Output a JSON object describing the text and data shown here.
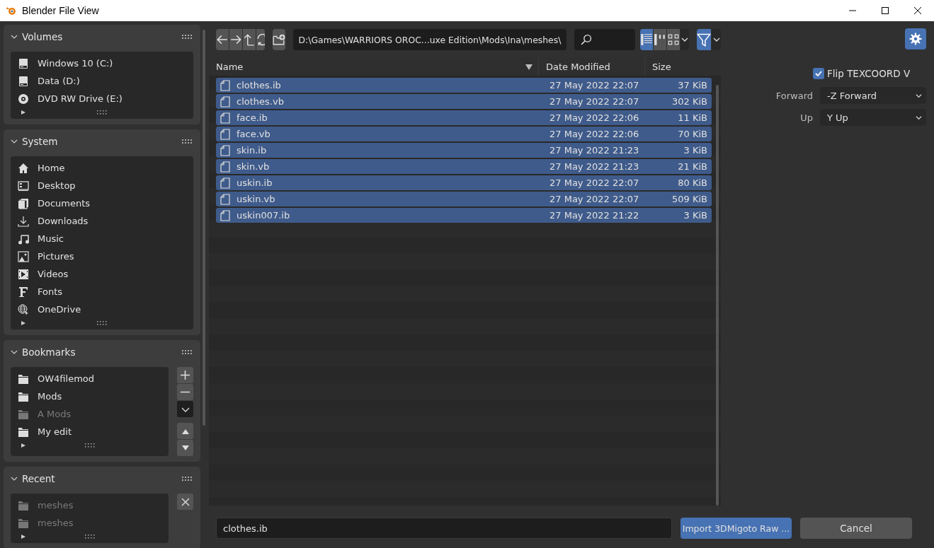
{
  "window": {
    "title": "Blender File View"
  },
  "sidebar": {
    "panels": [
      {
        "title": "Volumes",
        "expanded": true,
        "kind": "volumes",
        "items": [
          {
            "label": "Windows 10 (C:)",
            "kind": "drive",
            "disabled": false
          },
          {
            "label": "Data (D:)",
            "kind": "drive",
            "disabled": false
          },
          {
            "label": "DVD RW Drive (E:)",
            "kind": "disc",
            "disabled": false
          }
        ]
      },
      {
        "title": "System",
        "expanded": true,
        "kind": "system",
        "items": [
          {
            "label": "Home",
            "kind": "home",
            "disabled": false
          },
          {
            "label": "Desktop",
            "kind": "desktop",
            "disabled": false
          },
          {
            "label": "Documents",
            "kind": "documents",
            "disabled": false
          },
          {
            "label": "Downloads",
            "kind": "downloads",
            "disabled": false
          },
          {
            "label": "Music",
            "kind": "music",
            "disabled": false
          },
          {
            "label": "Pictures",
            "kind": "pictures",
            "disabled": false
          },
          {
            "label": "Videos",
            "kind": "videos",
            "disabled": false
          },
          {
            "label": "Fonts",
            "kind": "fonts",
            "disabled": false
          },
          {
            "label": "OneDrive",
            "kind": "network",
            "disabled": false
          }
        ]
      },
      {
        "title": "Bookmarks",
        "expanded": true,
        "kind": "bookmarks",
        "items": [
          {
            "label": "OW4filemod",
            "kind": "folder",
            "disabled": false
          },
          {
            "label": "Mods",
            "kind": "folder",
            "disabled": false
          },
          {
            "label": "A Mods",
            "kind": "folder",
            "disabled": true
          },
          {
            "label": "My edit",
            "kind": "folder",
            "disabled": false
          }
        ]
      },
      {
        "title": "Recent",
        "expanded": true,
        "kind": "recent",
        "items": [
          {
            "label": "meshes",
            "kind": "folder",
            "disabled": true
          },
          {
            "label": "meshes",
            "kind": "folder",
            "disabled": true
          }
        ]
      }
    ]
  },
  "toolbar": {
    "path": "D:\\Games\\WARRIORS OROC...uxe Edition\\Mods\\Ina\\meshes\\",
    "view_modes": [
      {
        "kind": "vertical",
        "selected": true
      },
      {
        "kind": "horizontal",
        "selected": false
      },
      {
        "kind": "thumbnails",
        "selected": false
      }
    ],
    "filter_on": true,
    "settings_on": true
  },
  "table": {
    "columns": [
      "Name",
      "Date Modified",
      "Size"
    ],
    "rows": [
      {
        "name": "clothes.ib",
        "date": "27 May 2022 22:07",
        "size": "37 KiB",
        "selected": true
      },
      {
        "name": "clothes.vb",
        "date": "27 May 2022 22:07",
        "size": "302 KiB",
        "selected": true
      },
      {
        "name": "face.ib",
        "date": "27 May 2022 22:06",
        "size": "11 KiB",
        "selected": true
      },
      {
        "name": "face.vb",
        "date": "27 May 2022 22:06",
        "size": "70 KiB",
        "selected": true
      },
      {
        "name": "skin.ib",
        "date": "27 May 2022 21:23",
        "size": "3 KiB",
        "selected": true
      },
      {
        "name": "skin.vb",
        "date": "27 May 2022 21:23",
        "size": "21 KiB",
        "selected": true
      },
      {
        "name": "uskin.ib",
        "date": "27 May 2022 22:07",
        "size": "80 KiB",
        "selected": true
      },
      {
        "name": "uskin.vb",
        "date": "27 May 2022 22:07",
        "size": "509 KiB",
        "selected": true
      },
      {
        "name": "uskin007.ib",
        "date": "27 May 2022 21:22",
        "size": "3 KiB",
        "selected": true
      }
    ]
  },
  "options": {
    "flip_texcoord": {
      "label": "Flip TEXCOORD V",
      "checked": true
    },
    "fields": [
      {
        "label": "Forward",
        "value": "-Z Forward"
      },
      {
        "label": "Up",
        "value": "Y Up"
      }
    ]
  },
  "bottom": {
    "filename": "clothes.ib",
    "import_button": "Import 3DMigoto Raw ...",
    "cancel_button": "Cancel"
  }
}
